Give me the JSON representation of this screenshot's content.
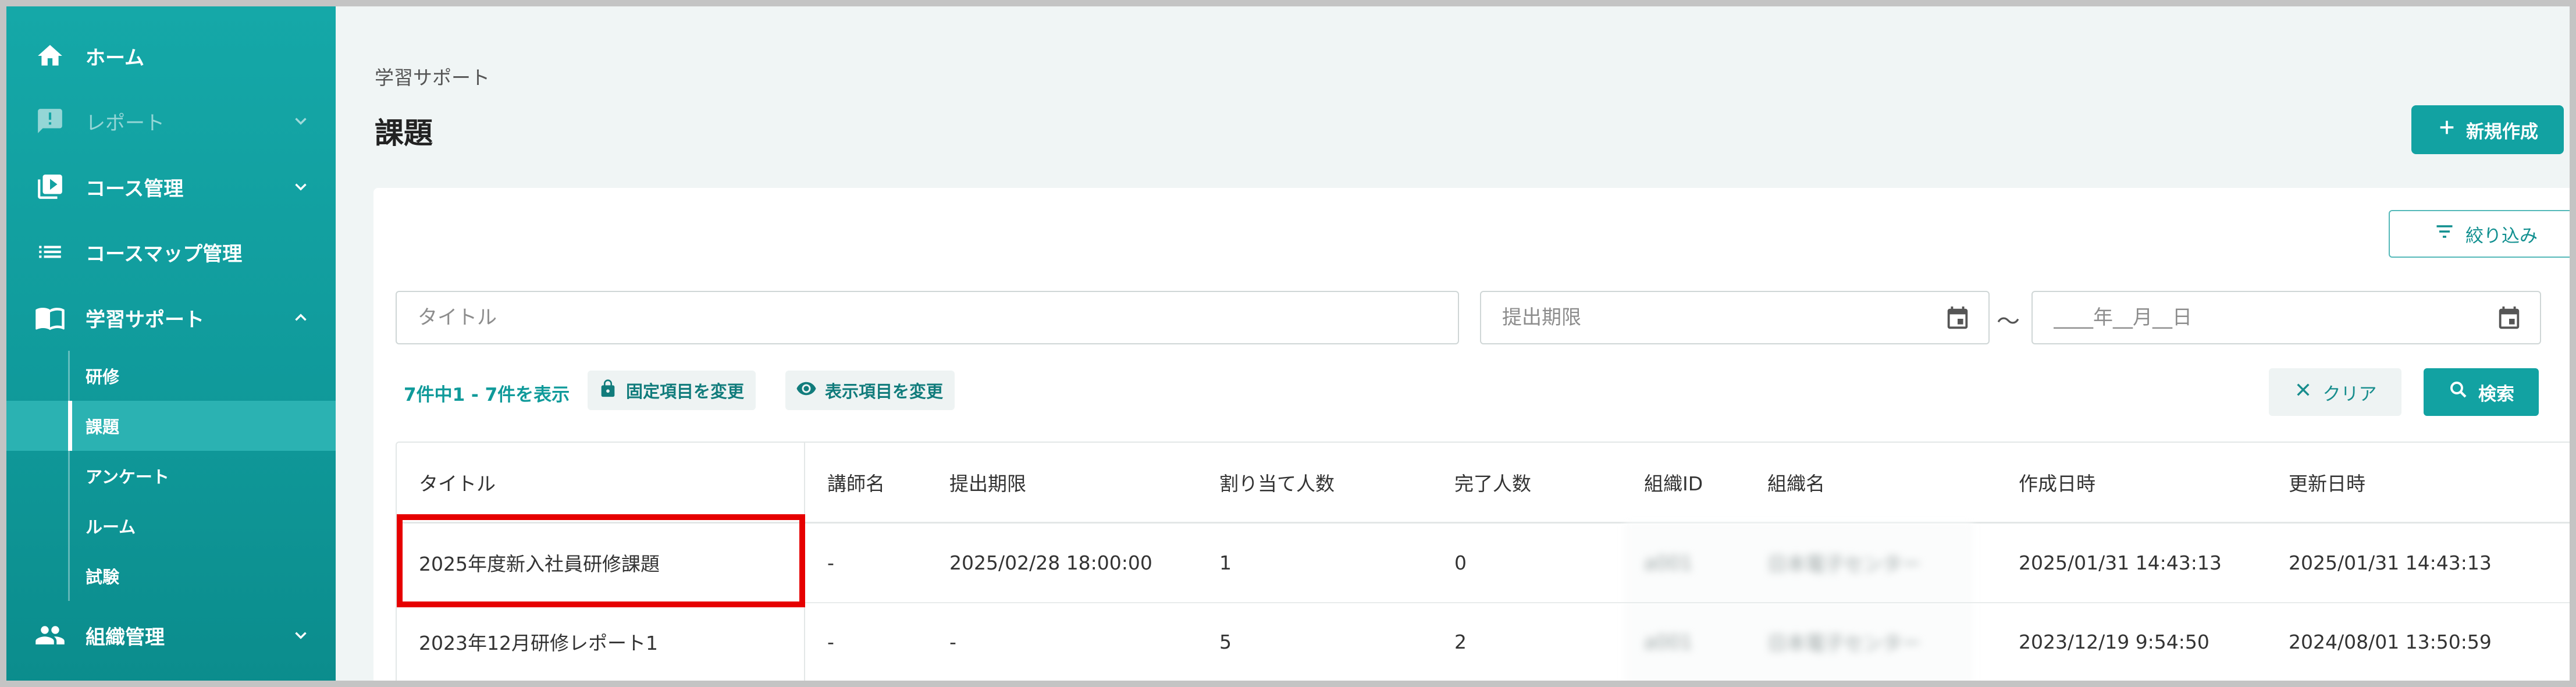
{
  "sidebar": {
    "items": [
      {
        "label": "ホーム",
        "icon": "home-icon"
      },
      {
        "label": "レポート",
        "icon": "report-icon"
      },
      {
        "label": "コース管理",
        "icon": "course-icon"
      },
      {
        "label": "コースマップ管理",
        "icon": "list-icon"
      },
      {
        "label": "学習サポート",
        "icon": "book-icon"
      },
      {
        "label": "組織管理",
        "icon": "people-icon"
      }
    ],
    "sub_items": [
      {
        "label": "研修"
      },
      {
        "label": "課題"
      },
      {
        "label": "アンケート"
      },
      {
        "label": "ルーム"
      },
      {
        "label": "試験"
      }
    ]
  },
  "header": {
    "breadcrumb": "学習サポート",
    "title": "課題",
    "new_button": "新規作成"
  },
  "filters": {
    "filter_button": "絞り込み",
    "title_placeholder": "タイトル",
    "deadline_placeholder": "提出期限",
    "separator": "～",
    "date_placeholder": "____年__月__日",
    "clear_button": "クリア",
    "search_button": "検索"
  },
  "toolbar": {
    "count_text": "7件中1 - 7件を表示",
    "fixed_items_button": "固定項目を変更",
    "display_items_button": "表示項目を変更"
  },
  "table": {
    "headers": [
      "タイトル",
      "講師名",
      "提出期限",
      "割り当て人数",
      "完了人数",
      "組織ID",
      "組織名",
      "作成日時",
      "更新日時"
    ],
    "rows": [
      [
        "2025年度新入社員研修課題",
        "-",
        "2025/02/28 18:00:00",
        "1",
        "0",
        "a001",
        "日本電子センター",
        "2025/01/31 14:43:13",
        "2025/01/31 14:43:13"
      ],
      [
        "2023年12月研修レポート1",
        "-",
        "-",
        "5",
        "2",
        "a001",
        "日本電子センター",
        "2023/12/19 9:54:50",
        "2024/08/01 13:50:59"
      ]
    ]
  },
  "colors": {
    "sidebar": "#12a2a2",
    "accent": "#12a2a2",
    "highlight": "#e60000"
  }
}
